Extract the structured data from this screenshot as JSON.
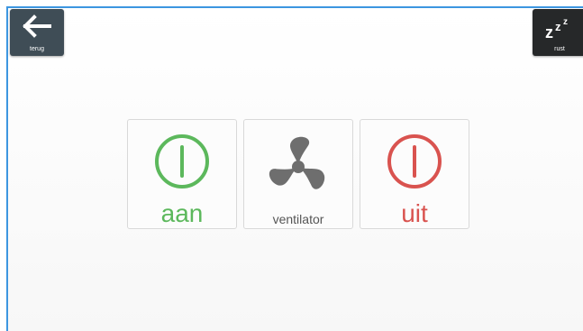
{
  "toolbar": {
    "back_label": "terug",
    "rest_label": "rust"
  },
  "controls": {
    "on_label": "aan",
    "device_label": "ventilator",
    "off_label": "uit"
  },
  "colors": {
    "on": "#5cb85c",
    "off": "#d9534f",
    "frame_border": "#3d96e0"
  },
  "icons": {
    "back": "arrow-left-icon",
    "rest": "sleep-zzz-icon",
    "on": "power-icon",
    "device": "fan-icon",
    "off": "power-icon"
  }
}
